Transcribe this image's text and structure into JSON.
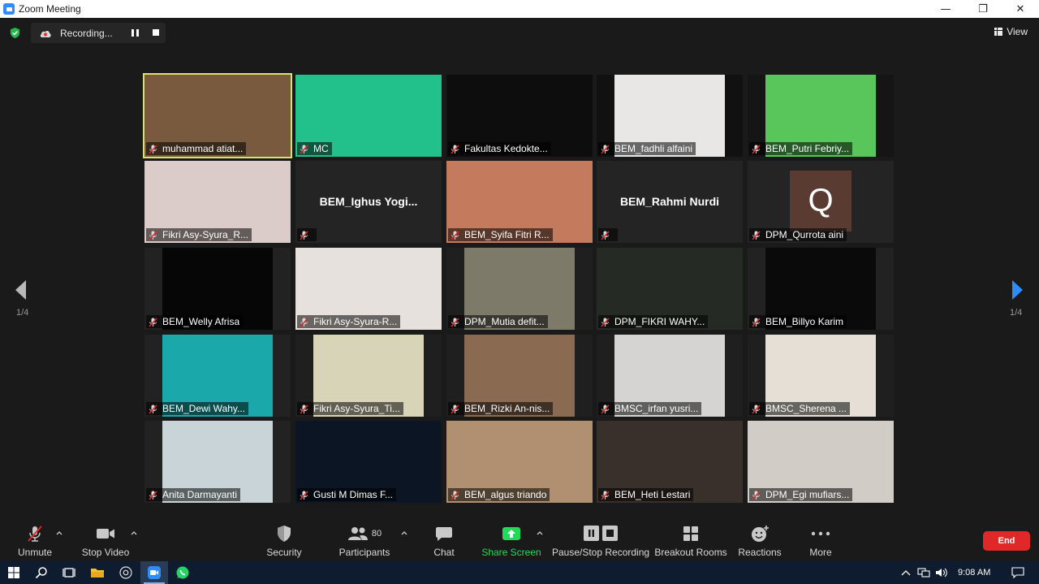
{
  "window": {
    "title": "Zoom Meeting",
    "minimize_glyph": "—",
    "restore_glyph": "❐",
    "close_glyph": "✕"
  },
  "top": {
    "recording_label": "Recording...",
    "view_label": "View"
  },
  "pagination": {
    "left": "1/4",
    "right": "1/4"
  },
  "participants": [
    {
      "name": "muhammad atiat...",
      "bg": "#4a3a2e",
      "video": "#7a5a3e",
      "active": true
    },
    {
      "name": "MC",
      "bg": "#1fc48a",
      "video": "#22c08b"
    },
    {
      "name": "Fakultas Kedokte...",
      "bg": "#050505",
      "video": "#0d0d0d"
    },
    {
      "name": "BEM_fadhli alfaini",
      "bg": "#111111",
      "video": "#e9e6e6",
      "narrow": true
    },
    {
      "name": "BEM_Putri Febriy...",
      "bg": "#151515",
      "video": "#58c65a",
      "narrow": true
    },
    {
      "name": "Fikri Asy-Syura_R...",
      "bg": "#d9c8c6",
      "video": "#dcccc9"
    },
    {
      "name": "",
      "big_name": "BEM_Ighus  Yogi...",
      "bg": "#242424"
    },
    {
      "name": "BEM_Syifa Fitri R...",
      "bg": "#b06a55",
      "video": "#c47a5d"
    },
    {
      "name": "",
      "big_name": "BEM_Rahmi Nurdi",
      "bg": "#242424"
    },
    {
      "name": "DPM_Qurrota aini",
      "bg": "#242424",
      "avatar": "Q"
    },
    {
      "name": "BEM_Welly Afrisa",
      "bg": "#222222",
      "video": "#060606",
      "narrow": true
    },
    {
      "name": "Fikri Asy-Syura-R...",
      "bg": "#e8e4e0",
      "video": "#e6e1dc"
    },
    {
      "name": "DPM_Mutia defit...",
      "bg": "#1f1f1f",
      "video": "#7d7a6a",
      "narrow": true
    },
    {
      "name": "DPM_FIKRI WAHY...",
      "bg": "#151515",
      "video": "#252b24"
    },
    {
      "name": "BEM_Billyo Karim",
      "bg": "#222222",
      "video": "#0a0a0a",
      "narrow": true
    },
    {
      "name": "BEM_Dewi Wahy...",
      "bg": "#222222",
      "video": "#1aa8aa",
      "narrow": true
    },
    {
      "name": "Fikri Asy-Syura_Ti...",
      "bg": "#1f1f1f",
      "video": "#d8d4b8",
      "narrow": true
    },
    {
      "name": "BEM_Rizki An-nis...",
      "bg": "#1f1f1f",
      "video": "#8b6a52",
      "narrow": true
    },
    {
      "name": "BMSC_irfan yusri...",
      "bg": "#1f1f1f",
      "video": "#d6d4d2",
      "narrow": true
    },
    {
      "name": "BMSC_Sherena ...",
      "bg": "#1f1f1f",
      "video": "#e5dfd6",
      "narrow": true
    },
    {
      "name": "Anita Darmayanti",
      "bg": "#222222",
      "video": "#c9d4d8",
      "narrow": true
    },
    {
      "name": "Gusti M Dimas F...",
      "bg": "#0a0a14",
      "video": "#0b1524"
    },
    {
      "name": "BEM_algus triando",
      "bg": "#a88968",
      "video": "#b09070"
    },
    {
      "name": "BEM_Heti Lestari",
      "bg": "#2b2623",
      "video": "#3a302b"
    },
    {
      "name": "DPM_Egi mufiars...",
      "bg": "#c8c2bc",
      "video": "#d2ccc6"
    }
  ],
  "controls": {
    "unmute": "Unmute",
    "stop_video": "Stop Video",
    "security": "Security",
    "participants": "Participants",
    "participants_count": "80",
    "chat": "Chat",
    "share_screen": "Share Screen",
    "pause_stop_recording": "Pause/Stop Recording",
    "breakout_rooms": "Breakout Rooms",
    "reactions": "Reactions",
    "more": "More",
    "end": "End"
  },
  "taskbar": {
    "time": "9:08 AM"
  },
  "colors": {
    "active_speaker": "#d9e26a",
    "share_green": "#23d959",
    "end_red": "#e02828",
    "zoom_blue": "#2d8cff"
  }
}
